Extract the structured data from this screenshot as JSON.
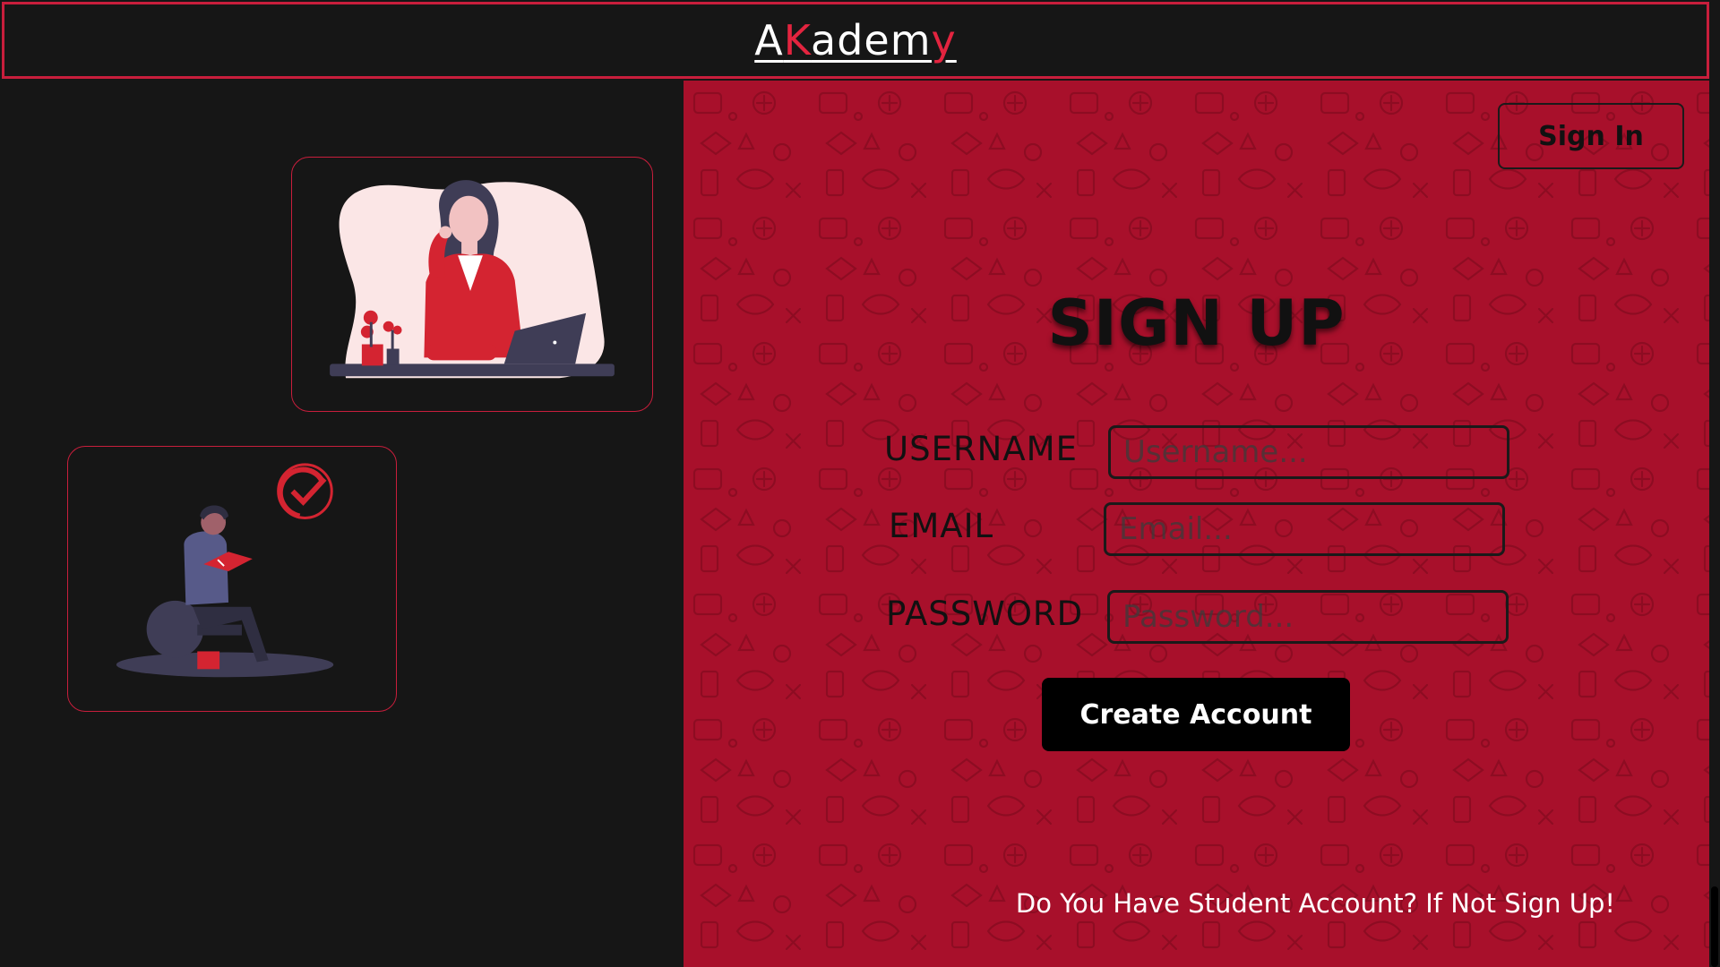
{
  "app": {
    "logo": {
      "part1": "A",
      "part2": "K",
      "part3": "adem",
      "part4": "y"
    }
  },
  "colors": {
    "accent": "#e3243f",
    "panel_red": "#a8102b",
    "dark_bg": "#161616",
    "border_red": "#c81e3c"
  },
  "left": {
    "illustrations": [
      {
        "icon": "woman-at-laptop-illustration"
      },
      {
        "icon": "man-reading-book-illustration"
      }
    ]
  },
  "header_actions": {
    "signin_label": "Sign In"
  },
  "form": {
    "title": "SIGN UP",
    "username_label": "USERNAME",
    "username_placeholder": "Username...",
    "username_value": "",
    "email_label": "EMAIL",
    "email_placeholder": "Email...",
    "email_value": "",
    "password_label": "PASSWORD",
    "password_placeholder": "Password...",
    "password_value": "",
    "submit_label": "Create Account"
  },
  "footer": {
    "note": "Do You Have Student Account? If Not Sign Up!"
  }
}
